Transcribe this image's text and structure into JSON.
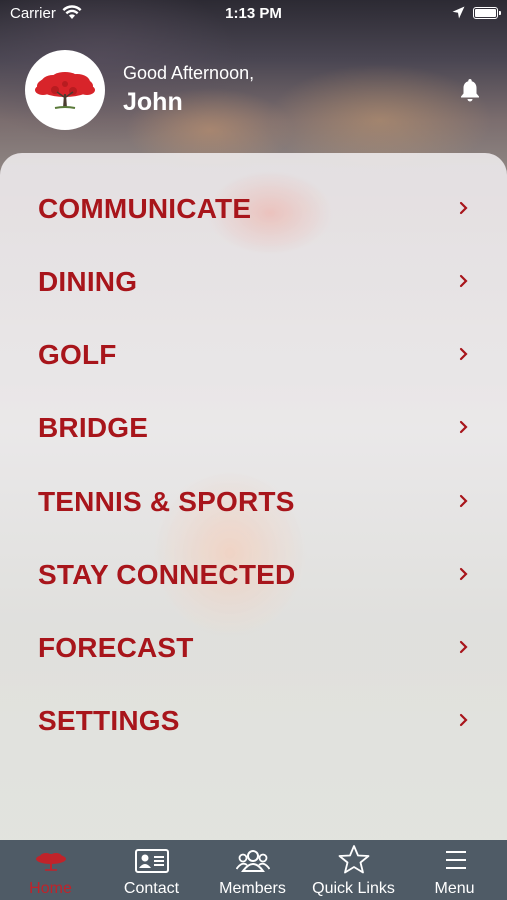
{
  "status_bar": {
    "carrier": "Carrier",
    "time": "1:13 PM"
  },
  "header": {
    "greeting": "Good Afternoon,",
    "user_name": "John"
  },
  "menu": {
    "items": [
      {
        "label": "COMMUNICATE"
      },
      {
        "label": "DINING"
      },
      {
        "label": "GOLF"
      },
      {
        "label": "BRIDGE"
      },
      {
        "label": "TENNIS & SPORTS"
      },
      {
        "label": "STAY CONNECTED"
      },
      {
        "label": "FORECAST"
      },
      {
        "label": "SETTINGS"
      }
    ]
  },
  "tab_bar": {
    "tabs": [
      {
        "label": "Home",
        "icon": "tree-icon",
        "active": true
      },
      {
        "label": "Contact",
        "icon": "contact-card-icon",
        "active": false
      },
      {
        "label": "Members",
        "icon": "members-icon",
        "active": false
      },
      {
        "label": "Quick Links",
        "icon": "star-icon",
        "active": false
      },
      {
        "label": "Menu",
        "icon": "hamburger-menu-icon",
        "active": false
      }
    ]
  },
  "colors": {
    "accent": "#a8151b",
    "tab_bar": "#4f5b66",
    "active_tab": "#c0232a"
  }
}
